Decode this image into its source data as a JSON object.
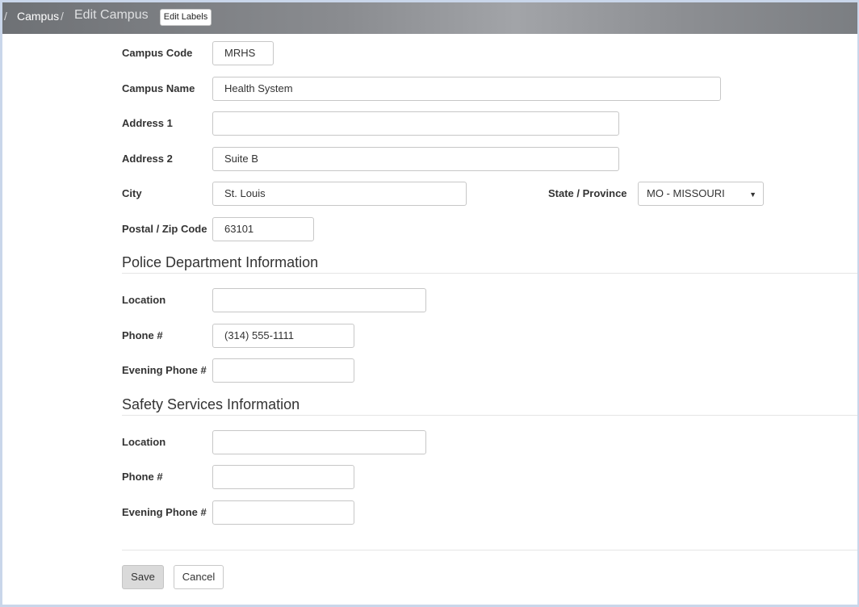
{
  "breadcrumb": {
    "separator": "/",
    "campus_link": "Campus",
    "current": "Edit Campus",
    "edit_labels_button": "Edit Labels"
  },
  "form": {
    "campus_code": {
      "label": "Campus Code",
      "value": "MRHS"
    },
    "campus_name": {
      "label": "Campus Name",
      "value": "Health System"
    },
    "address1": {
      "label": "Address 1",
      "value": ""
    },
    "address2": {
      "label": "Address 2",
      "value": "Suite B"
    },
    "city": {
      "label": "City",
      "value": "St. Louis"
    },
    "state": {
      "label": "State / Province",
      "value": "MO - MISSOURI"
    },
    "postal": {
      "label": "Postal / Zip Code",
      "value": "63101"
    }
  },
  "police": {
    "title": "Police Department Information",
    "location": {
      "label": "Location",
      "value": ""
    },
    "phone": {
      "label": "Phone #",
      "value": "(314) 555-1111"
    },
    "evening_phone": {
      "label": "Evening Phone #",
      "value": ""
    }
  },
  "safety": {
    "title": "Safety Services Information",
    "location": {
      "label": "Location",
      "value": ""
    },
    "phone": {
      "label": "Phone #",
      "value": ""
    },
    "evening_phone": {
      "label": "Evening Phone #",
      "value": ""
    }
  },
  "actions": {
    "save": "Save",
    "cancel": "Cancel"
  },
  "icons": {
    "select_caret": "caret-down-icon"
  }
}
